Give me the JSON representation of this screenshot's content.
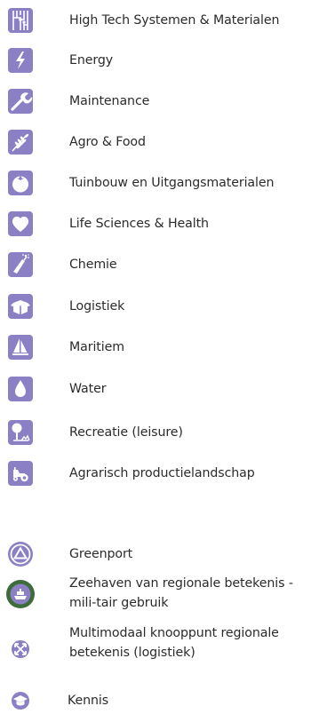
{
  "colors": {
    "tile": "#8b80c3",
    "tile_dark": "#6f63ad",
    "greenport_ring": "#8b80c3",
    "seaport_ring": "#3e6b3a",
    "icon_fg": "#ffffff"
  },
  "sectors": [
    {
      "label": "High Tech Systemen & Materialen",
      "icon": "circuit-icon"
    },
    {
      "label": "Energy",
      "icon": "lightning-icon"
    },
    {
      "label": "Maintenance",
      "icon": "wrench-icon"
    },
    {
      "label": "Agro & Food",
      "icon": "wheat-icon"
    },
    {
      "label": "Tuinbouw en Uitgangsmaterialen",
      "icon": "tomato-icon"
    },
    {
      "label": "Life Sciences & Health",
      "icon": "heart-icon"
    },
    {
      "label": "Chemie",
      "icon": "flask-icon"
    },
    {
      "label": "Logistiek",
      "icon": "box-icon"
    },
    {
      "label": "Maritiem",
      "icon": "sailboat-icon"
    },
    {
      "label": "Water",
      "icon": "water-drop-icon"
    },
    {
      "label": "Recreatie (leisure)",
      "icon": "tree-icon"
    },
    {
      "label": "Agrarisch productielandschap",
      "icon": "tractor-icon"
    }
  ],
  "locations": [
    {
      "label": "Greenport",
      "icon": "greenport-triangle-icon"
    },
    {
      "label": "Zeehaven van regionale betekenis - mili-tair gebruik",
      "icon": "seaport-ship-icon"
    },
    {
      "label": "Multimodaal knooppunt regionale betekenis (logistiek)",
      "icon": "multimodal-arrows-icon"
    },
    {
      "label": "Kennis",
      "icon": "graduation-cap-icon"
    }
  ]
}
